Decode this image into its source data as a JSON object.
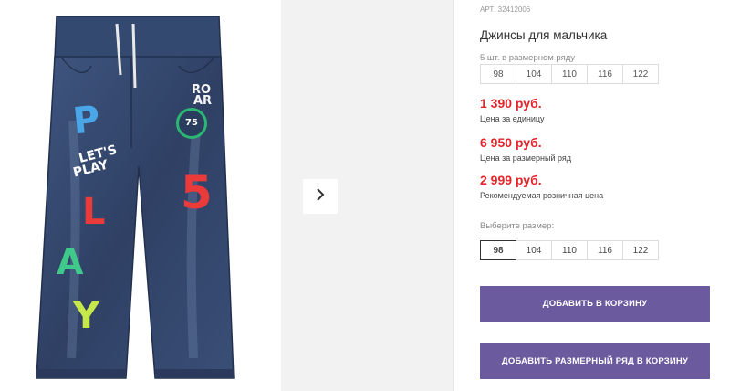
{
  "product": {
    "article": "АРТ: 32412006",
    "title": "Джинсы для мальчика"
  },
  "pack": {
    "label": "5 шт. в размерном ряду",
    "sizes": [
      "98",
      "104",
      "110",
      "116",
      "122"
    ]
  },
  "prices": [
    {
      "value": "1 390 руб.",
      "note": "Цена за единицу"
    },
    {
      "value": "6 950 руб.",
      "note": "Цена за размерный ряд"
    },
    {
      "value": "2 999 руб.",
      "note": "Рекомендуемая розничная цена"
    }
  ],
  "size_select": {
    "label": "Выберите размер:",
    "sizes": [
      "98",
      "104",
      "110",
      "116",
      "122"
    ],
    "selected": "98"
  },
  "buttons": {
    "add_to_cart": "ДОБАВИТЬ В КОРЗИНУ",
    "add_pack_to_cart": "ДОБАВИТЬ РАЗМЕРНЫЙ РЯД В КОРЗИНУ"
  },
  "photo_patches": {
    "roar_top": "RO",
    "roar_bottom": "AR",
    "number_badge": "75",
    "letter_p": "P",
    "lets": "LET'S",
    "play": "PLAY",
    "number_5": "5",
    "letter_l": "L",
    "letter_a": "A",
    "letter_y": "Y"
  },
  "icons": {
    "next": "chevron-right-icon"
  },
  "colors": {
    "accent_button": "#6c5a9e",
    "price_red": "#e3242b",
    "denim": "#34466a"
  }
}
